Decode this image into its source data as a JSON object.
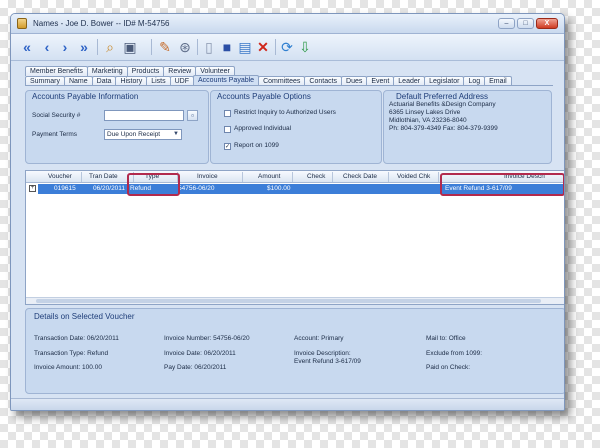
{
  "window": {
    "title": "Names - Joe D. Bower -- ID# M-54756",
    "controls": [
      "–",
      "□",
      "X"
    ]
  },
  "toolbar": {
    "buttons": [
      {
        "icon": "first-record-icon",
        "glyph": "«"
      },
      {
        "icon": "previous-record-icon",
        "glyph": "‹"
      },
      {
        "icon": "next-record-icon",
        "glyph": "›"
      },
      {
        "icon": "last-record-icon",
        "glyph": "»"
      },
      {
        "icon": "search-icon",
        "glyph": "⌕"
      },
      {
        "icon": "camera-icon",
        "glyph": "▣"
      },
      {
        "icon": "edit-icon",
        "glyph": "✎"
      },
      {
        "icon": "binoculars-icon",
        "glyph": "⊛"
      },
      {
        "icon": "new-document-icon",
        "glyph": "▯"
      },
      {
        "icon": "save-icon",
        "glyph": "■"
      },
      {
        "icon": "print-preview-icon",
        "glyph": "▤"
      },
      {
        "icon": "delete-icon",
        "glyph": "✕"
      },
      {
        "icon": "refresh-icon",
        "glyph": "⟳"
      },
      {
        "icon": "export-icon",
        "glyph": "⇩"
      }
    ]
  },
  "tabs_row1": [
    "Member Benefits",
    "Marketing",
    "Products",
    "Review",
    "Volunteer"
  ],
  "tabs_row2": [
    "Summary",
    "Name",
    "Data",
    "History",
    "Lists",
    "UDF",
    "Accounts Payable",
    "Committees",
    "Contacts",
    "Dues",
    "Event",
    "Leader",
    "Legislator",
    "Log",
    "Email"
  ],
  "active_tab": "Accounts Payable",
  "ap_info": {
    "title": "Accounts Payable Information",
    "ssn_label": "Social Security #",
    "ssn_value": "",
    "terms_label": "Payment Terms",
    "terms_value": "Due Upon Receipt"
  },
  "ap_options": {
    "title": "Accounts Payable Options",
    "options": [
      {
        "label": "Restrict Inquiry to Authorized Users",
        "checked": false
      },
      {
        "label": "Approved Individual",
        "checked": false
      },
      {
        "label": "Report on 1099",
        "checked": true
      }
    ]
  },
  "address": {
    "title": "Default Preferred Address",
    "lines": [
      "Actuarial Benefits &Design Company",
      "6365 Linsey Lakes Drive",
      "Midlothian, VA 23236-8040",
      "Ph: 804-379-4349   Fax: 804-379-9399"
    ]
  },
  "grid": {
    "columns": [
      "Voucher",
      "Tran Date",
      "Type",
      "Invoice",
      "Amount",
      "Check",
      "Check Date",
      "Voided Chk",
      "Invoice Descri"
    ],
    "rows": [
      {
        "voucher": "019615",
        "tran_date": "06/20/2011",
        "type": "Refund",
        "invoice": "54756-06/20",
        "amount": "$100.00",
        "check": "",
        "check_date": "",
        "voided": "",
        "description": "Event Refund 3-617/09"
      }
    ]
  },
  "details": {
    "title": "Details on Selected Voucher",
    "transaction_date": "Transaction Date: 06/20/2011",
    "transaction_type": "Transaction Type: Refund",
    "invoice_amount": "Invoice Amount: 100.00",
    "invoice_number": "Invoice Number: 54756-06/20",
    "invoice_date": "Invoice Date: 06/20/2011",
    "pay_date": "Pay Date: 06/20/2011",
    "account": "Account: Primary",
    "invoice_description_label": "Invoice Description:",
    "invoice_description": "Event Refund 3-617/09",
    "mail_to": "Mail to: Office",
    "exclude_1099": "Exclude from 1099:",
    "paid_on_check": "Paid on Check:"
  },
  "colors": {
    "selection": "#3c7ed8",
    "highlight_box": "#b22a4d",
    "panel_bg": "#c8d9ef"
  }
}
